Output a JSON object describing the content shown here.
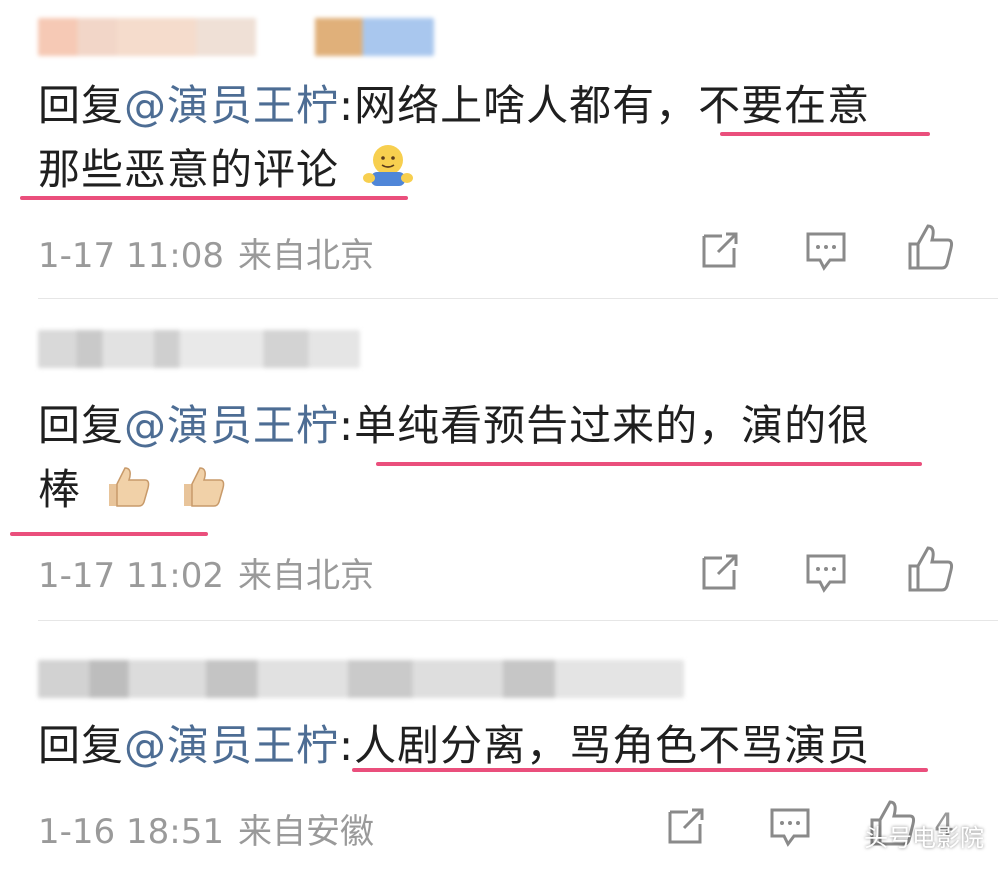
{
  "colors": {
    "mention": "#4d6d94",
    "text": "#1f1f1f",
    "meta": "#9a9a9a",
    "highlight": "#ea4f7c",
    "divider": "#e6e6e6"
  },
  "comments": [
    {
      "prefix": "回复",
      "mention": "@演员王柠",
      "line1": ":网络上啥人都有，不要在意",
      "line2": "那些恶意的评论",
      "emoji": "hugging-emoji",
      "time": "1-17 11:08",
      "location": "来自北京",
      "actions": [
        "share-icon",
        "comment-icon",
        "like-icon"
      ]
    },
    {
      "prefix": "回复",
      "mention": "@演员王柠",
      "line1": ":单纯看预告过来的，演的很",
      "line2": "棒",
      "emoji": "thumbs-up-emoji",
      "time": "1-17 11:02",
      "location": "来自北京",
      "actions": [
        "share-icon",
        "comment-icon",
        "like-icon"
      ]
    },
    {
      "prefix": "回复",
      "mention": "@演员王柠",
      "line1": ":人剧分离，骂角色不骂演员",
      "time": "1-16 18:51",
      "location": "来自安徽",
      "actions": [
        "share-icon",
        "comment-icon",
        "like-icon"
      ],
      "like_count": "4"
    }
  ],
  "watermark": "头号电影院"
}
